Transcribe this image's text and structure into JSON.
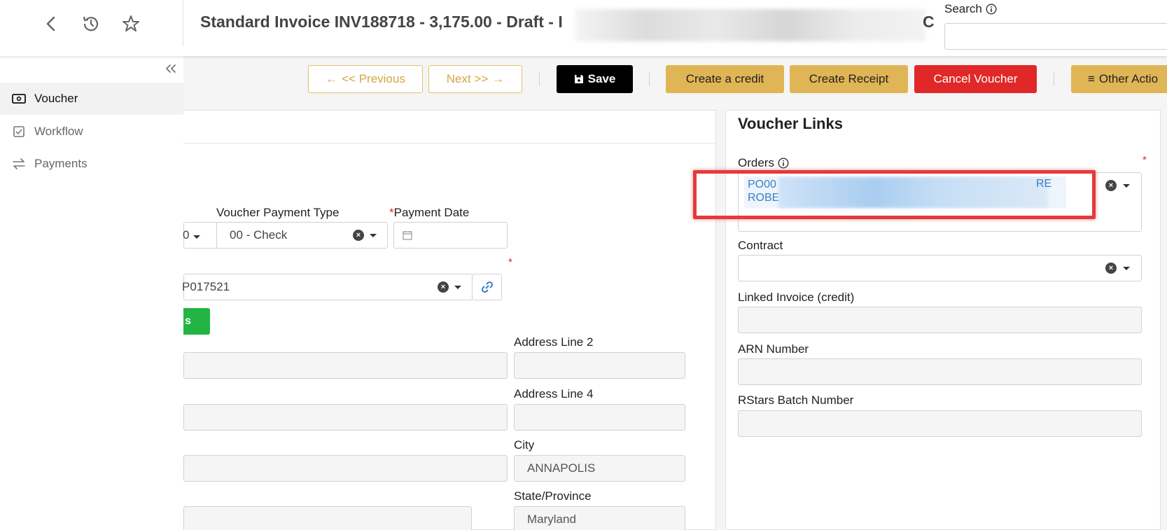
{
  "header": {
    "title": "Standard Invoice INV188718 - 3,175.00 - Draft - I",
    "title_tail": "C",
    "search_label": "Search"
  },
  "sidebar": {
    "items": [
      {
        "label": "Voucher",
        "icon": "money-icon",
        "active": true
      },
      {
        "label": "Workflow",
        "icon": "checkbox-icon",
        "active": false
      },
      {
        "label": "Payments",
        "icon": "transfer-icon",
        "active": false
      }
    ]
  },
  "toolbar": {
    "previous_label": "<< Previous",
    "next_label": "Next >>",
    "save_label": "Save",
    "create_credit_label": "Create a credit",
    "create_receipt_label": "Create Receipt",
    "cancel_voucher_label": "Cancel Voucher",
    "other_actions_label": "Other Actio"
  },
  "form": {
    "voucher_payment_type_label": "Voucher Payment Type",
    "voucher_payment_type_value": "00 - Check",
    "payment_date_label": "Payment Date",
    "partial_field_value": "0",
    "vendor_value": "P017521",
    "green_button_label": "s",
    "address_line2_label": "Address Line 2",
    "address_line4_label": "Address Line 4",
    "city_label": "City",
    "city_value": "ANNAPOLIS",
    "state_label": "State/Province",
    "state_value": "Maryland"
  },
  "voucher_links": {
    "title": "Voucher Links",
    "orders_label": "Orders",
    "order_line1": "PO00",
    "order_line1_tail": "RE",
    "order_line2": "ROBE",
    "contract_label": "Contract",
    "linked_invoice_label": "Linked Invoice (credit)",
    "arn_label": "ARN Number",
    "rstars_label": "RStars Batch Number"
  },
  "colors": {
    "accent_gold": "#e0b555",
    "danger_red": "#e02828",
    "success_green": "#22b544",
    "link_blue": "#3a7fc6"
  }
}
